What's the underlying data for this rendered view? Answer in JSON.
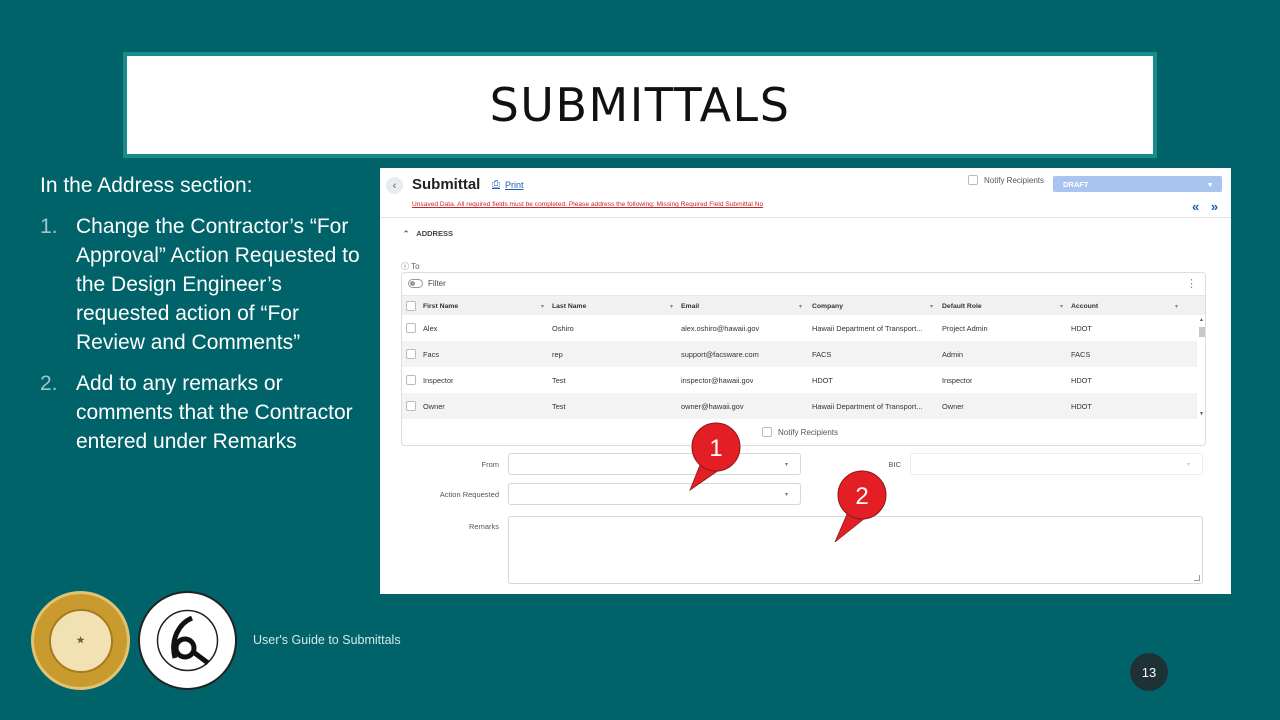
{
  "slide": {
    "title": "SUBMITTALS",
    "intro": "In the Address section:",
    "steps": [
      {
        "num": "1.",
        "text": "Change the Contractor’s “For Approval” Action Requested to the Design Engineer’s requested action of “For Review and Comments”"
      },
      {
        "num": "2.",
        "text": "Add to any remarks or comments that the Contractor entered under Remarks"
      }
    ],
    "footer": "User's Guide to Submittals",
    "page_number": "13",
    "callouts": [
      "1",
      "2"
    ]
  },
  "app": {
    "title": "Submittal",
    "print_label": "Print",
    "warning": "Unsaved Data. All required fields must be completed. Please address the following: Missing Required Field Submittal No",
    "notify_label": "Notify Recipients",
    "status": "DRAFT",
    "nav_arrows": "« »",
    "section": "ADDRESS",
    "to_label": "To",
    "filter_label": "Filter",
    "columns": [
      "First Name",
      "Last Name",
      "Email",
      "Company",
      "Default Role",
      "Account"
    ],
    "rows": [
      [
        "Alex",
        "Oshiro",
        "alex.oshiro@hawaii.gov",
        "Hawaii Department of Transport...",
        "Project Admin",
        "HDOT"
      ],
      [
        "Facs",
        "rep",
        "support@facsware.com",
        "FACS",
        "Admin",
        "FACS"
      ],
      [
        "Inspector",
        "Test",
        "inspector@hawaii.gov",
        "HDOT",
        "Inspector",
        "HDOT"
      ],
      [
        "Owner",
        "Test",
        "owner@hawaii.gov",
        "Hawaii Department of Transport...",
        "Owner",
        "HDOT"
      ]
    ],
    "grid_notify_label": "Notify Recipients",
    "form": {
      "from_label": "From",
      "bic_label": "BIC",
      "action_label": "Action Requested",
      "remarks_label": "Remarks"
    }
  },
  "colors": {
    "background": "#00636a",
    "title_border": "#1a8b8b",
    "callout": "#e31e24",
    "link": "#1f5fb0"
  }
}
